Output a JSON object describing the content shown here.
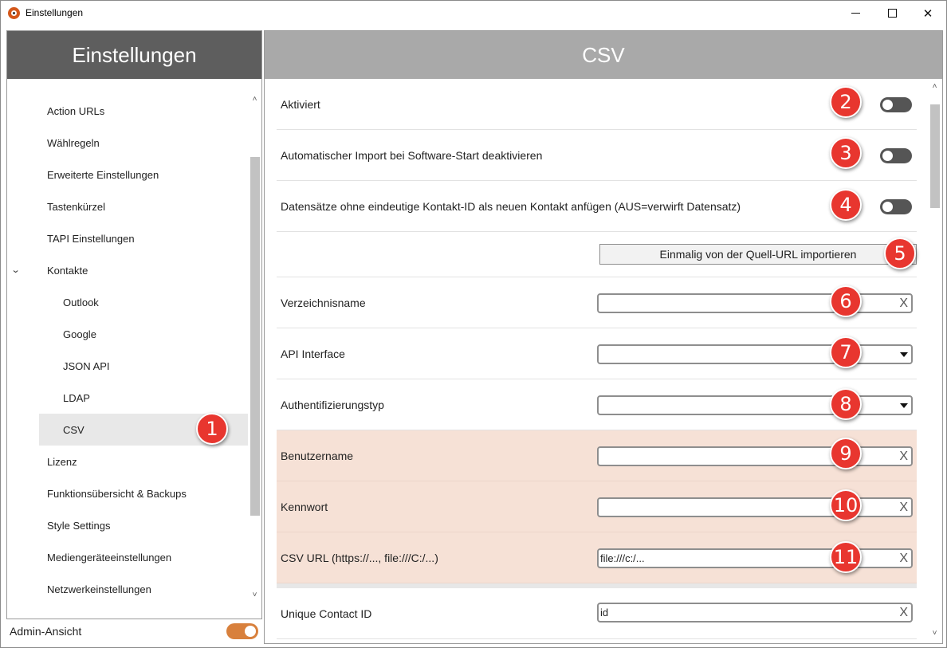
{
  "window": {
    "title": "Einstellungen",
    "icon": "app-logo-icon"
  },
  "sidebar": {
    "header": "Einstellungen",
    "items": [
      {
        "label": "Action URLs"
      },
      {
        "label": "Wählregeln"
      },
      {
        "label": "Erweiterte Einstellungen"
      },
      {
        "label": "Tastenkürzel"
      },
      {
        "label": "TAPI Einstellungen"
      },
      {
        "label": "Kontakte",
        "expanded": true
      },
      {
        "label": "Outlook",
        "sub": true
      },
      {
        "label": "Google",
        "sub": true
      },
      {
        "label": "JSON API",
        "sub": true
      },
      {
        "label": "LDAP",
        "sub": true
      },
      {
        "label": "CSV",
        "sub": true,
        "selected": true
      },
      {
        "label": "Lizenz"
      },
      {
        "label": "Funktionsübersicht & Backups"
      },
      {
        "label": "Style Settings"
      },
      {
        "label": "Mediengeräteeinstellungen"
      },
      {
        "label": "Netzwerkeinstellungen"
      }
    ],
    "admin_label": "Admin-Ansicht",
    "admin_enabled": true
  },
  "main": {
    "header": "CSV",
    "rows": {
      "aktiviert": {
        "label": "Aktiviert",
        "enabled": false
      },
      "auto_import": {
        "label": "Automatischer Import bei Software-Start deaktivieren",
        "enabled": false
      },
      "datensaetze": {
        "label": "Datensätze ohne eindeutige Kontakt-ID als neuen Kontakt anfügen (AUS=verwirft Datensatz)",
        "enabled": false
      },
      "import_button": "Einmalig von der Quell-URL importieren",
      "verzeichnisname": {
        "label": "Verzeichnisname",
        "value": ""
      },
      "api_interface": {
        "label": "API Interface",
        "value": ""
      },
      "auth_typ": {
        "label": "Authentifizierungstyp",
        "value": ""
      },
      "benutzername": {
        "label": "Benutzername",
        "value": ""
      },
      "kennwort": {
        "label": "Kennwort",
        "value": ""
      },
      "csv_url": {
        "label": "CSV URL (https://..., file:///C:/...)",
        "value": "file:///c:/..."
      },
      "unique_id": {
        "label": "Unique Contact ID",
        "value": "id"
      }
    },
    "clear_glyph": "X"
  },
  "callouts": [
    "1",
    "2",
    "3",
    "4",
    "5",
    "6",
    "7",
    "8",
    "9",
    "10",
    "11"
  ],
  "colors": {
    "sidebar_header": "#5e5e5e",
    "main_header": "#a9a9a9",
    "highlight_rows": "#f6e1d6",
    "admin_toggle": "#d8803c",
    "toggle_off": "#555555",
    "callout": "#e8362f"
  }
}
